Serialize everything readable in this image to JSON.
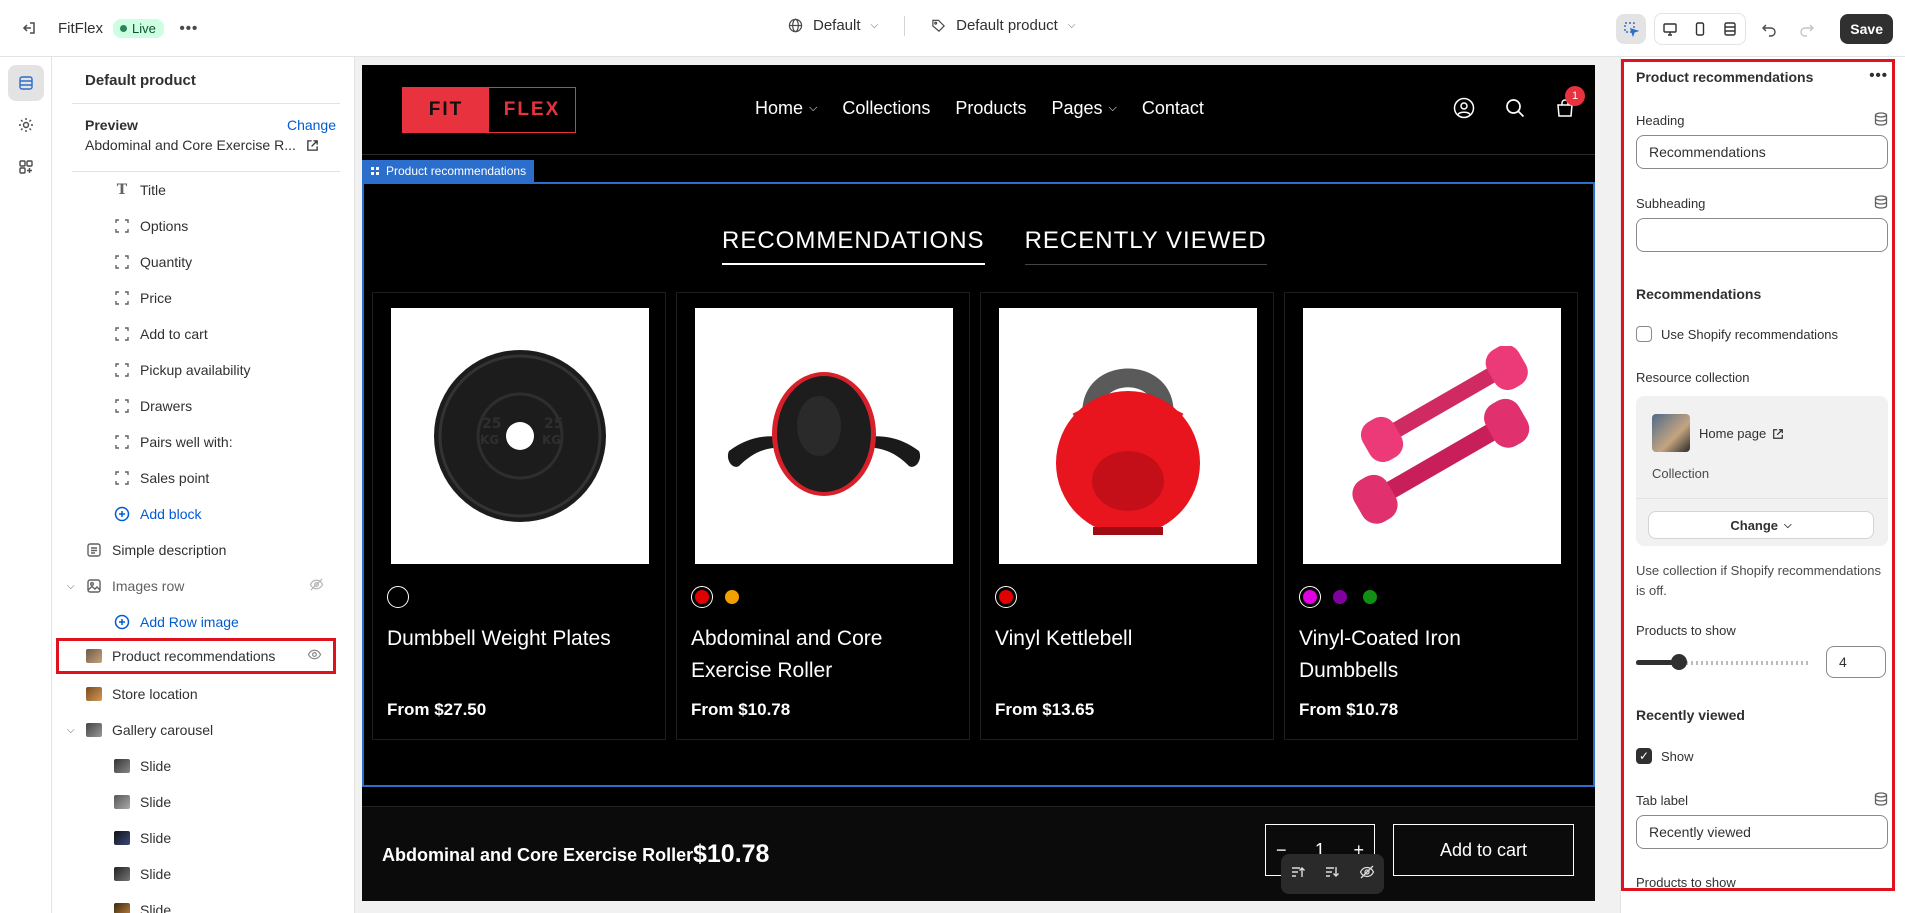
{
  "topbar": {
    "app_name": "FitFlex",
    "live_label": "Live",
    "theme_select": "Default",
    "template_select": "Default product",
    "save_label": "Save"
  },
  "sidebar": {
    "title": "Default product",
    "preview_label": "Preview",
    "preview_change": "Change",
    "preview_value": "Abdominal and Core Exercise R...",
    "items": [
      {
        "label": "Title",
        "icon": "title-icon"
      },
      {
        "label": "Options",
        "icon": "block-icon"
      },
      {
        "label": "Quantity",
        "icon": "block-icon"
      },
      {
        "label": "Price",
        "icon": "block-icon"
      },
      {
        "label": "Add to cart",
        "icon": "block-icon"
      },
      {
        "label": "Pickup availability",
        "icon": "block-icon"
      },
      {
        "label": "Drawers",
        "icon": "block-icon"
      },
      {
        "label": "Pairs well with:",
        "icon": "block-icon"
      },
      {
        "label": "Sales point",
        "icon": "block-icon"
      },
      {
        "label": "Add block",
        "icon": "plus-circle-icon"
      },
      {
        "label": "Simple description",
        "icon": "text-icon"
      },
      {
        "label": "Images row",
        "icon": "image-icon"
      },
      {
        "label": "Add Row image",
        "icon": "plus-circle-icon"
      },
      {
        "label": "Product recommendations",
        "icon": "thumbnail-icon"
      },
      {
        "label": "Store location",
        "icon": "thumbnail-icon"
      },
      {
        "label": "Gallery carousel",
        "icon": "thumbnail-icon"
      },
      {
        "label": "Slide",
        "icon": "thumbnail-icon"
      },
      {
        "label": "Slide",
        "icon": "thumbnail-icon"
      },
      {
        "label": "Slide",
        "icon": "thumbnail-icon"
      },
      {
        "label": "Slide",
        "icon": "thumbnail-icon"
      },
      {
        "label": "Slide",
        "icon": "thumbnail-icon"
      }
    ]
  },
  "store": {
    "logo_left": "FIT",
    "logo_right": "FLEX",
    "nav": [
      "Home",
      "Collections",
      "Products",
      "Pages",
      "Contact"
    ],
    "cart_count": "1",
    "section_tag": "Product recommendations",
    "tabs": [
      "RECOMMENDATIONS",
      "RECENTLY VIEWED"
    ],
    "products": [
      {
        "title": "Dumbbell Weight Plates",
        "price": "From $27.50",
        "swatches": [
          "#000000"
        ]
      },
      {
        "title": "Abdominal and Core Exercise Roller",
        "price": "From $10.78",
        "swatches": [
          "#e00000",
          "#f0a000"
        ]
      },
      {
        "title": "Vinyl Kettlebell",
        "price": "From $13.65",
        "swatches": [
          "#e00000"
        ]
      },
      {
        "title": "Vinyl-Coated Iron Dumbbells",
        "price": "From $10.78",
        "swatches": [
          "#e000e0",
          "#8000a0",
          "#109010"
        ]
      }
    ],
    "sticky_name": "Abdominal and Core Exercise Roller",
    "sticky_price": "$10.78",
    "qty": "1",
    "add_to_cart": "Add to cart"
  },
  "panel": {
    "title": "Product recommendations",
    "heading_label": "Heading",
    "heading_value": "Recommendations",
    "subheading_label": "Subheading",
    "subheading_value": "",
    "recommendations_title": "Recommendations",
    "use_shopify_label": "Use Shopify recommendations",
    "resource_label": "Resource collection",
    "collection_name": "Home page",
    "collection_type": "Collection",
    "change_label": "Change",
    "help_text": "Use collection if Shopify recommendations is off.",
    "products_to_show_label": "Products to show",
    "products_to_show_value": "4",
    "recently_viewed_title": "Recently viewed",
    "show_label": "Show",
    "tab_label_label": "Tab label",
    "tab_label_value": "Recently viewed",
    "products_to_show_label_2": "Products to show"
  },
  "colors": {
    "accent": "#e8323d",
    "selection": "#2c6ecb",
    "highlight": "#e0121f"
  }
}
